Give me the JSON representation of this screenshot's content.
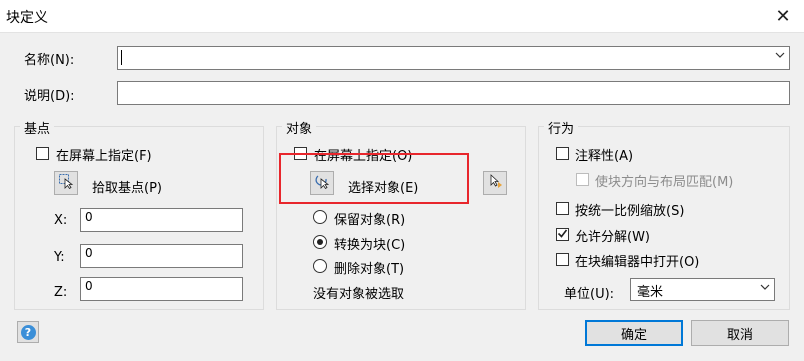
{
  "window": {
    "title": "块定义",
    "close_glyph": "✕"
  },
  "name_field": {
    "label": "名称(N):",
    "value": ""
  },
  "desc_field": {
    "label": "说明(D):",
    "value": ""
  },
  "basepoint": {
    "title": "基点",
    "specify_label": "在屏幕上指定(F)",
    "pick_label": "拾取基点(P)",
    "x_label": "X:",
    "x_value": "0",
    "y_label": "Y:",
    "y_value": "0",
    "z_label": "Z:",
    "z_value": "0"
  },
  "objects": {
    "title": "对象",
    "specify_label": "在屏幕上指定(O)",
    "select_label": "选择对象(E)",
    "retain_label": "保留对象(R)",
    "convert_label": "转换为块(C)",
    "delete_label": "删除对象(T)",
    "status": "没有对象被选取",
    "selected_option": "convert"
  },
  "behavior": {
    "title": "行为",
    "annotative_label": "注释性(A)",
    "match_orientation_label": "使块方向与布局匹配(M)",
    "uniform_scale_label": "按统一比例缩放(S)",
    "allow_explode_label": "允许分解(W)",
    "allow_explode_checked": true,
    "open_editor_label": "在块编辑器中打开(O)",
    "unit_label": "单位(U):",
    "unit_value": "毫米"
  },
  "buttons": {
    "ok": "确定",
    "cancel": "取消",
    "help": "?"
  },
  "colors": {
    "accent": "#0078d7",
    "highlight": "#e8262c"
  }
}
